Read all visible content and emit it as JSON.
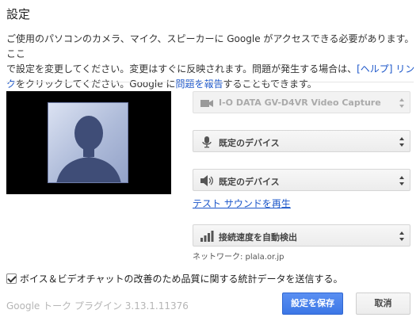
{
  "dialog": {
    "title": "設定"
  },
  "description": {
    "line1": "ご使用のパソコンのカメラ、マイク、スピーカーに Google がアクセスできる必要があります。ここ",
    "line2_before_link": "で設定を変更してください。変更はすぐに反映されます。問題が発生する場合は、",
    "help_link": "[ヘルプ] リン",
    "line3_prefix": "ク",
    "line3_mid": "をクリックしてください。Google に",
    "report_link": "問題を報告",
    "line3_suffix": "することもできます。"
  },
  "devices": {
    "camera": {
      "label": "I-O DATA GV-D4VR Video Capture",
      "icon": "video-camera-icon",
      "disabled": true
    },
    "microphone": {
      "label": "既定のデバイス",
      "icon": "microphone-icon"
    },
    "speaker": {
      "label": "既定のデバイス",
      "icon": "speaker-icon"
    },
    "test_sound_link": "テスト サウンドを再生",
    "connection": {
      "label": "接続速度を自動検出",
      "icon": "signal-bars-icon"
    },
    "network_info": "ネットワーク: plala.or.jp"
  },
  "stats_checkbox": {
    "label": "ボイス＆ビデオチャットの改善のため品質に関する統計データを送信する。",
    "checked": true
  },
  "footer": {
    "version": "Google トーク プラグイン 3.13.1.11376",
    "save_label": "設定を保存",
    "cancel_label": "取消"
  },
  "colors": {
    "link": "#1a55c9",
    "primary_button": "#3c77e6"
  }
}
